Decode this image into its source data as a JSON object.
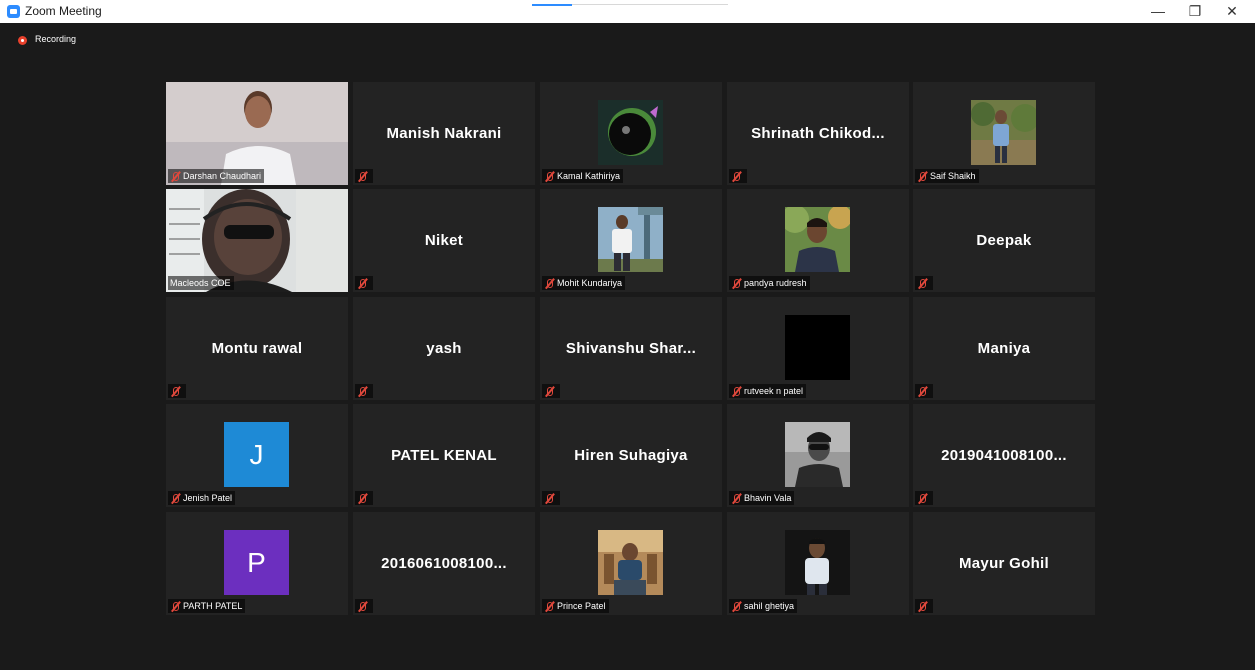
{
  "window": {
    "title": "Zoom Meeting",
    "min": "—",
    "max": "❐",
    "close": "✕"
  },
  "recording": "Recording",
  "tiles": [
    {
      "label": "Darshan Chaudhari"
    },
    {
      "name": "Manish Nakrani"
    },
    {
      "label": "Kamal Kathiriya"
    },
    {
      "name": "Shrinath  Chikod..."
    },
    {
      "label": "Saif Shaikh"
    },
    {
      "label": "Macleods COE"
    },
    {
      "name": "Niket"
    },
    {
      "label": "Mohit Kundariya"
    },
    {
      "label": "pandya rudresh"
    },
    {
      "name": "Deepak"
    },
    {
      "name": "Montu rawal"
    },
    {
      "name": "yash"
    },
    {
      "name": "Shivanshu  Shar..."
    },
    {
      "label": "rutveek n patel"
    },
    {
      "name": "Maniya"
    },
    {
      "label": "Jenish Patel",
      "initial": "J"
    },
    {
      "name": "PATEL KENAL"
    },
    {
      "name": "Hiren Suhagiya"
    },
    {
      "label": "Bhavin Vala"
    },
    {
      "name": "2019041008100..."
    },
    {
      "label": "PARTH PATEL",
      "initial": "P"
    },
    {
      "name": "2016061008100..."
    },
    {
      "label": "Prince Patel"
    },
    {
      "label": "sahil ghetiya"
    },
    {
      "name": "Mayur Gohil"
    }
  ]
}
